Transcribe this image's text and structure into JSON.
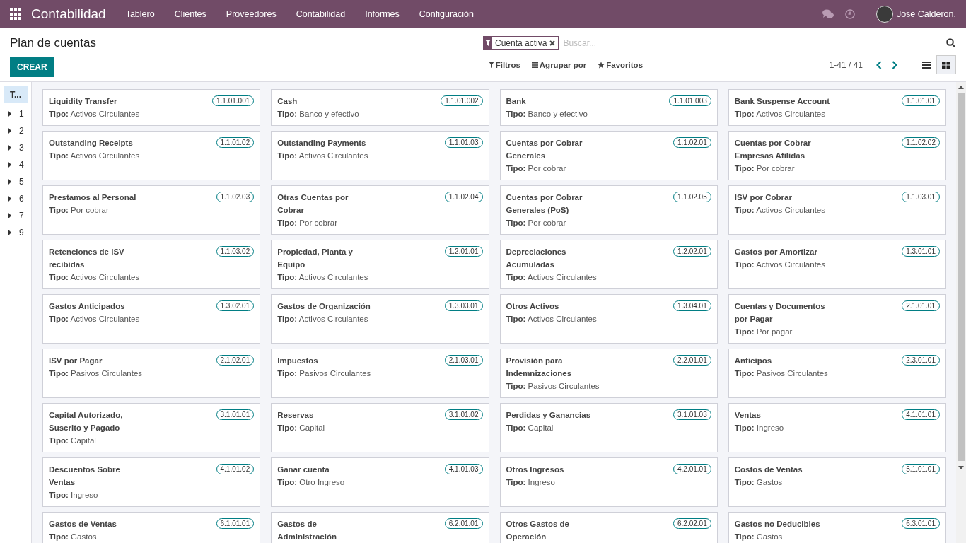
{
  "navbar": {
    "app_title": "Contabilidad",
    "menu": [
      "Tablero",
      "Clientes",
      "Proveedores",
      "Contabilidad",
      "Informes",
      "Configuración"
    ],
    "user": "Jose Calderon."
  },
  "control_panel": {
    "breadcrumb": "Plan de cuentas",
    "create_button": "CREAR",
    "facets": [
      {
        "label": "Cuenta activa"
      }
    ],
    "search": {
      "placeholder": "Buscar..."
    },
    "filters": [
      "Filtros",
      "Agrupar por",
      "Favoritos"
    ],
    "pager": "1-41 / 41",
    "views": [
      {
        "kind": "list",
        "selected": false
      },
      {
        "kind": "kanban",
        "selected": true
      }
    ]
  },
  "sidebar": {
    "header": {
      "label": "T...",
      "selected": true
    },
    "items": [
      {
        "label": "1",
        "expanded": false
      },
      {
        "label": "2",
        "expanded": false
      },
      {
        "label": "3",
        "expanded": false
      },
      {
        "label": "4",
        "expanded": false
      },
      {
        "label": "5",
        "expanded": false
      },
      {
        "label": "6",
        "expanded": false
      },
      {
        "label": "7",
        "expanded": false
      },
      {
        "label": "9",
        "expanded": false
      }
    ]
  },
  "cards": [
    {
      "name": "Liquidity Transfer",
      "code": "1.1.01.001",
      "tipo_label": "Tipo:",
      "tipo": "Activos Circulantes"
    },
    {
      "name": "Cash",
      "code": "1.1.01.002",
      "tipo_label": "Tipo:",
      "tipo": "Banco y efectivo"
    },
    {
      "name": "Bank",
      "code": "1.1.01.003",
      "tipo_label": "Tipo:",
      "tipo": "Banco y efectivo"
    },
    {
      "name": "Bank Suspense Account",
      "code": "1.1.01.01",
      "tipo_label": "Tipo:",
      "tipo": "Activos Circulantes"
    },
    {
      "name": "Outstanding Receipts",
      "code": "1.1.01.02",
      "tipo_label": "Tipo:",
      "tipo": "Activos Circulantes"
    },
    {
      "name": "Outstanding Payments",
      "code": "1.1.01.03",
      "tipo_label": "Tipo:",
      "tipo": "Activos Circulantes"
    },
    {
      "name": "Cuentas por Cobrar Generales",
      "code": "1.1.02.01",
      "tipo_label": "Tipo:",
      "tipo": "Por cobrar"
    },
    {
      "name": "Cuentas por Cobrar Empresas Afilidas",
      "code": "1.1.02.02",
      "tipo_label": "Tipo:",
      "tipo": "Por cobrar"
    },
    {
      "name": "Prestamos al Personal",
      "code": "1.1.02.03",
      "tipo_label": "Tipo:",
      "tipo": "Por cobrar"
    },
    {
      "name": "Otras Cuentas por Cobrar",
      "code": "1.1.02.04",
      "tipo_label": "Tipo:",
      "tipo": "Por cobrar"
    },
    {
      "name": "Cuentas por Cobrar Generales (PoS)",
      "code": "1.1.02.05",
      "tipo_label": "Tipo:",
      "tipo": "Por cobrar"
    },
    {
      "name": "ISV por Cobrar",
      "code": "1.1.03.01",
      "tipo_label": "Tipo:",
      "tipo": "Activos Circulantes"
    },
    {
      "name": "Retenciones de ISV recibidas",
      "code": "1.1.03.02",
      "tipo_label": "Tipo:",
      "tipo": "Activos Circulantes"
    },
    {
      "name": "Propiedad, Planta y Equipo",
      "code": "1.2.01.01",
      "tipo_label": "Tipo:",
      "tipo": "Activos Circulantes"
    },
    {
      "name": "Depreciaciones Acumuladas",
      "code": "1.2.02.01",
      "tipo_label": "Tipo:",
      "tipo": "Activos Circulantes"
    },
    {
      "name": "Gastos por Amortizar",
      "code": "1.3.01.01",
      "tipo_label": "Tipo:",
      "tipo": "Activos Circulantes"
    },
    {
      "name": "Gastos Anticipados",
      "code": "1.3.02.01",
      "tipo_label": "Tipo:",
      "tipo": "Activos Circulantes"
    },
    {
      "name": "Gastos de Organización",
      "code": "1.3.03.01",
      "tipo_label": "Tipo:",
      "tipo": "Activos Circulantes"
    },
    {
      "name": "Otros Activos",
      "code": "1.3.04.01",
      "tipo_label": "Tipo:",
      "tipo": "Activos Circulantes"
    },
    {
      "name": "Cuentas y Documentos por Pagar",
      "code": "2.1.01.01",
      "tipo_label": "Tipo:",
      "tipo": "Por pagar"
    },
    {
      "name": "ISV por Pagar",
      "code": "2.1.02.01",
      "tipo_label": "Tipo:",
      "tipo": "Pasivos Circulantes"
    },
    {
      "name": "Impuestos",
      "code": "2.1.03.01",
      "tipo_label": "Tipo:",
      "tipo": "Pasivos Circulantes"
    },
    {
      "name": "Provisión para Indemnizaciones",
      "code": "2.2.01.01",
      "tipo_label": "Tipo:",
      "tipo": "Pasivos Circulantes"
    },
    {
      "name": "Anticipos",
      "code": "2.3.01.01",
      "tipo_label": "Tipo:",
      "tipo": "Pasivos Circulantes"
    },
    {
      "name": "Capital Autorizado, Suscrito y Pagado",
      "code": "3.1.01.01",
      "tipo_label": "Tipo:",
      "tipo": "Capital"
    },
    {
      "name": "Reservas",
      "code": "3.1.01.02",
      "tipo_label": "Tipo:",
      "tipo": "Capital"
    },
    {
      "name": "Perdidas y Ganancias",
      "code": "3.1.01.03",
      "tipo_label": "Tipo:",
      "tipo": "Capital"
    },
    {
      "name": "Ventas",
      "code": "4.1.01.01",
      "tipo_label": "Tipo:",
      "tipo": "Ingreso"
    },
    {
      "name": "Descuentos Sobre Ventas",
      "code": "4.1.01.02",
      "tipo_label": "Tipo:",
      "tipo": "Ingreso"
    },
    {
      "name": "Ganar cuenta",
      "code": "4.1.01.03",
      "tipo_label": "Tipo:",
      "tipo": "Otro Ingreso"
    },
    {
      "name": "Otros Ingresos",
      "code": "4.2.01.01",
      "tipo_label": "Tipo:",
      "tipo": "Ingreso"
    },
    {
      "name": "Costos de Ventas",
      "code": "5.1.01.01",
      "tipo_label": "Tipo:",
      "tipo": "Gastos"
    },
    {
      "name": "Gastos de Ventas",
      "code": "6.1.01.01",
      "tipo_label": "Tipo:",
      "tipo": "Gastos"
    },
    {
      "name": "Gastos de Administración",
      "code": "6.2.01.01"
    },
    {
      "name": "Otros Gastos de Operación",
      "code": "6.2.02.01"
    },
    {
      "name": "Gastos no Deducibles",
      "code": "6.3.01.01",
      "tipo_label": "Tipo:",
      "tipo": "Gastos"
    }
  ]
}
